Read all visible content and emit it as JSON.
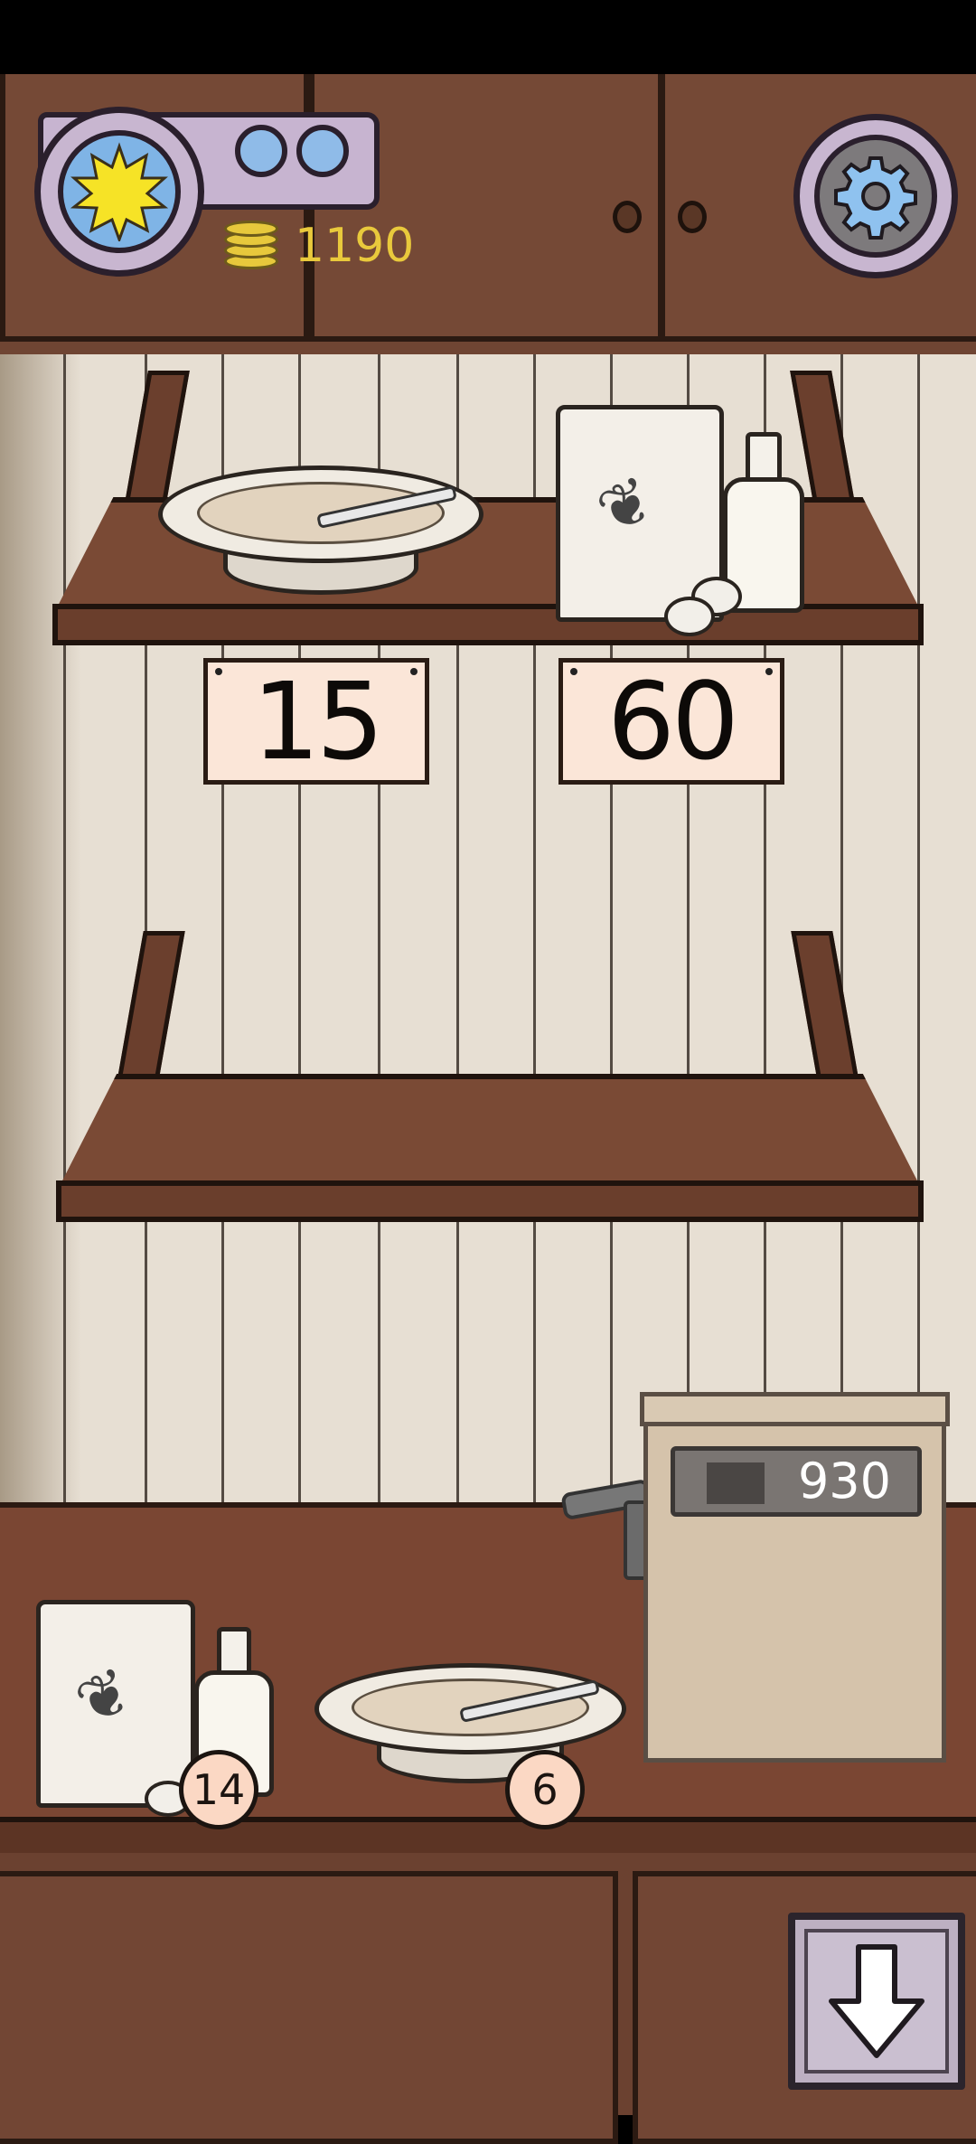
{
  "hud": {
    "coins": "1190",
    "weather_icon": "sun-icon",
    "settings_icon": "gear-icon"
  },
  "shop_shelf": {
    "items": [
      {
        "name": "porridge",
        "price": "15"
      },
      {
        "name": "flour-milk-eggs",
        "price": "60"
      }
    ]
  },
  "counter": {
    "items": [
      {
        "name": "flour-milk-eggs",
        "count": "14"
      },
      {
        "name": "porridge",
        "count": "6"
      }
    ],
    "register_display": "930"
  },
  "nav": {
    "down_icon": "arrow-down-icon"
  },
  "colors": {
    "wood": "#7a4a35",
    "wall": "#e7dfd3",
    "hud_panel": "#c7b4d0",
    "coin_text": "#e9c93c"
  }
}
